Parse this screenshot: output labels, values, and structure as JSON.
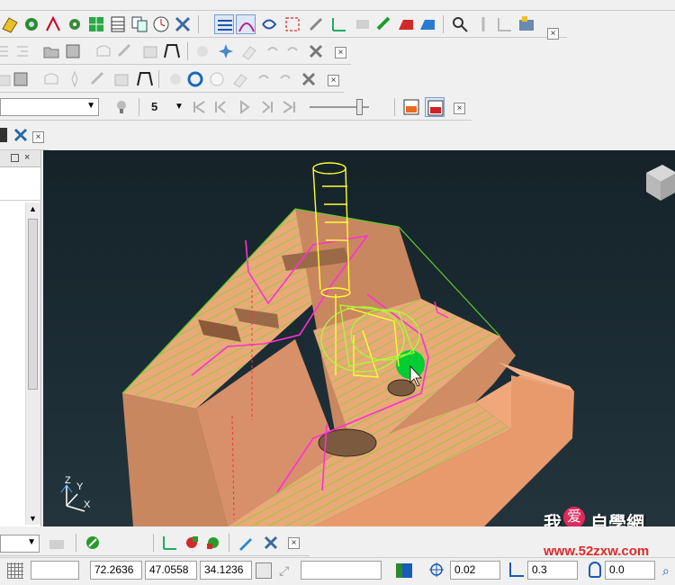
{
  "toolbars": {
    "row5_icon_names": [
      "pencil-icon",
      "mill-icon"
    ],
    "frame_step_value": "5"
  },
  "coords": {
    "x": "72.2636",
    "y": "47.0558",
    "z": "34.1236"
  },
  "status": {
    "tolerance": "0.02",
    "stepover": "0.3",
    "offset": "0.0"
  },
  "axis": {
    "z_label": "Z",
    "y_label": "Y",
    "x_label": "X"
  },
  "watermark": {
    "text_cn_1": "我",
    "text_cn_2": "爱",
    "text_cn_3": "自學網",
    "url": "www.52zxw.com"
  },
  "colors": {
    "viewport_bg": "#1a2a31",
    "part": "#e7a071",
    "part_dark": "#c98760",
    "hatch": "#7bdc2a",
    "toolpath": "#ff2fd6",
    "tool": "#ffff33",
    "holder": "#00cc33"
  }
}
